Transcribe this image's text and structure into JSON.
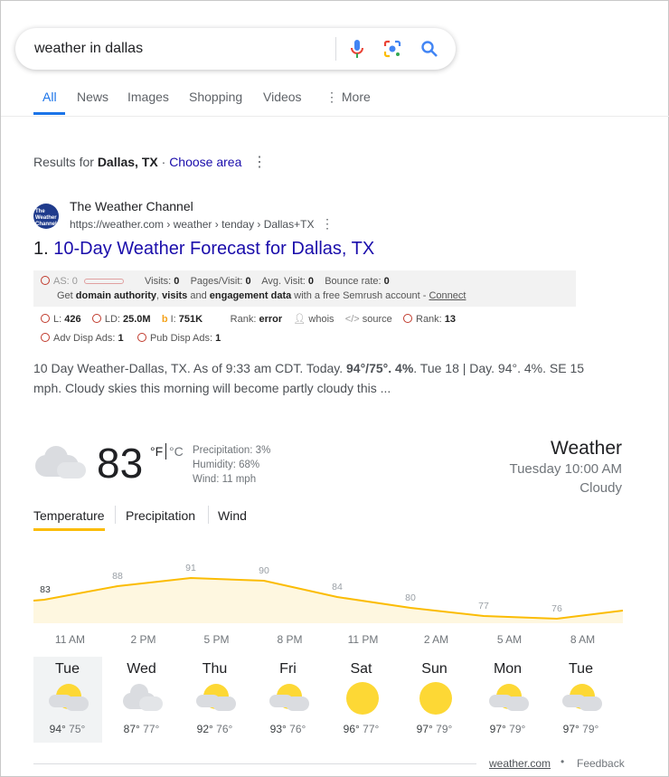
{
  "search": {
    "query": "weather in dallas"
  },
  "tabs": [
    "All",
    "News",
    "Images",
    "Shopping",
    "Videos",
    "More"
  ],
  "results_for": {
    "prefix": "Results for ",
    "location": "Dallas, TX",
    "separator": " · ",
    "choose": "Choose area"
  },
  "result": {
    "site": "The Weather Channel",
    "url": "https://weather.com › weather › tenday › Dallas+TX",
    "number": "1.",
    "title": "10-Day Weather Forecast for Dallas, TX",
    "snippet_parts": [
      "10 Day Weather-Dallas, TX. As of 9:33 am CDT. Today. ",
      "94°/75°. 4%",
      ". Tue 18 | Day. 94°. 4%. SE 15 mph. Cloudy skies this morning will become partly cloudy this ..."
    ]
  },
  "semrush": {
    "as": "AS: 0",
    "visits": [
      "Visits: ",
      "0"
    ],
    "pages": [
      "Pages/Visit: ",
      "0"
    ],
    "avg": [
      "Avg. Visit: ",
      "0"
    ],
    "bounce": [
      "Bounce rate: ",
      "0"
    ],
    "promo": [
      "Get ",
      "domain authority",
      ", ",
      "visits",
      " and ",
      "engagement data",
      " with a free Semrush account - ",
      "Connect"
    ],
    "l": [
      "L: ",
      "426"
    ],
    "ld": [
      "LD: ",
      "25.0M"
    ],
    "i": [
      "I: ",
      "751K"
    ],
    "rank": [
      "Rank: ",
      "error"
    ],
    "whois": "whois",
    "source": "source",
    "rank2": [
      "Rank: ",
      "13"
    ],
    "adv": [
      "Adv Disp Ads: ",
      "1"
    ],
    "pub": [
      "Pub Disp Ads: ",
      "1"
    ]
  },
  "weather": {
    "temp": "83",
    "unit_f": "°F",
    "unit_c": "°C",
    "precip": "Precipitation: 3%",
    "humidity": "Humidity: 68%",
    "wind": "Wind: 11 mph",
    "title": "Weather",
    "time": "Tuesday 10:00 AM",
    "cond": "Cloudy",
    "tabs": [
      "Temperature",
      "Precipitation",
      "Wind"
    ],
    "hourly_temps": [
      83,
      88,
      91,
      90,
      84,
      80,
      77,
      76
    ],
    "hours": [
      "11 AM",
      "2 PM",
      "5 PM",
      "8 PM",
      "11 PM",
      "2 AM",
      "5 AM",
      "8 AM"
    ],
    "days": [
      {
        "d": "Tue",
        "hi": "94°",
        "lo": "75°",
        "icon": "partly-cloudy"
      },
      {
        "d": "Wed",
        "hi": "87°",
        "lo": "77°",
        "icon": "cloudy"
      },
      {
        "d": "Thu",
        "hi": "92°",
        "lo": "76°",
        "icon": "partly-cloudy"
      },
      {
        "d": "Fri",
        "hi": "93°",
        "lo": "76°",
        "icon": "partly-cloudy"
      },
      {
        "d": "Sat",
        "hi": "96°",
        "lo": "77°",
        "icon": "sunny"
      },
      {
        "d": "Sun",
        "hi": "97°",
        "lo": "79°",
        "icon": "sunny"
      },
      {
        "d": "Mon",
        "hi": "97°",
        "lo": "79°",
        "icon": "partly-cloudy"
      },
      {
        "d": "Tue",
        "hi": "97°",
        "lo": "79°",
        "icon": "partly-cloudy"
      }
    ],
    "source": "weather.com",
    "feedback": "Feedback",
    "accent": "#fbbc04"
  }
}
